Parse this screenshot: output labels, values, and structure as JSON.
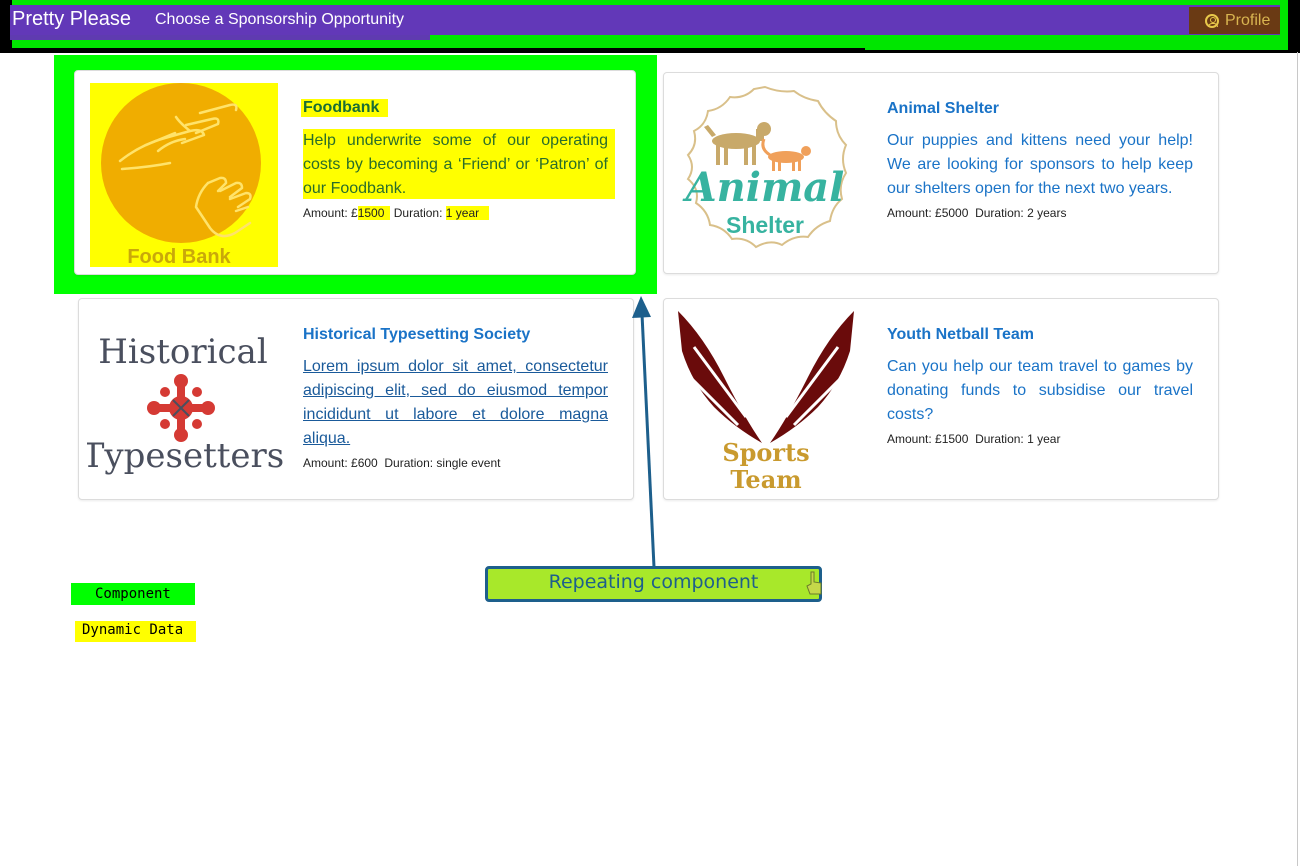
{
  "nav": {
    "brand": "Pretty Please",
    "link": "Choose a Sponsorship Opportunity",
    "profile_label": "Profile",
    "colors": {
      "bar": "#6238b8",
      "profile_bg": "#6a3a14",
      "highlight": "#00ff00"
    }
  },
  "cards": [
    {
      "title": "Foodbank",
      "description": "Help underwrite some of our operating costs by becoming a ‘Friend’ or ‘Patron’ of our Foodbank.",
      "amount_label": "Amount: £",
      "amount_value": "1500",
      "duration_label": "Duration:",
      "duration_value": "1 year",
      "logo_text": "Food Bank",
      "logo_icon": "helping-hands-icon"
    },
    {
      "title": "Animal Shelter",
      "description": "Our puppies and kittens need your help! We are looking for sponsors to help keep our shelters open for the next two years.",
      "amount_label": "Amount: £5000",
      "duration_label": "Duration: 2 years",
      "logo_word1": "Animal",
      "logo_word2": "Shelter",
      "logo_icon": "dog-cat-icon"
    },
    {
      "title": "Historical Typesetting Society",
      "description": "Lorem ipsum dolor sit amet, consectetur adipiscing elit, sed do eiusmod tempor incididunt ut labore et dolore magna aliqua.",
      "amount_label": "Amount: £600",
      "duration_label": "Duration: single event",
      "logo_word1": "Historical",
      "logo_word2": "Typesetters",
      "logo_icon": "ornament-cross-icon"
    },
    {
      "title": "Youth Netball Team",
      "description": "Can you help our team travel to games by donating funds to subsidise our travel costs?",
      "amount_label": "Amount: £1500",
      "duration_label": "Duration: 1 year",
      "logo_word1": "Sports",
      "logo_word2": "Team",
      "logo_icon": "wings-icon"
    }
  ],
  "legend": {
    "component": "Component",
    "dynamic_data": "Dynamic Data"
  },
  "callout": {
    "text": "Repeating component"
  }
}
